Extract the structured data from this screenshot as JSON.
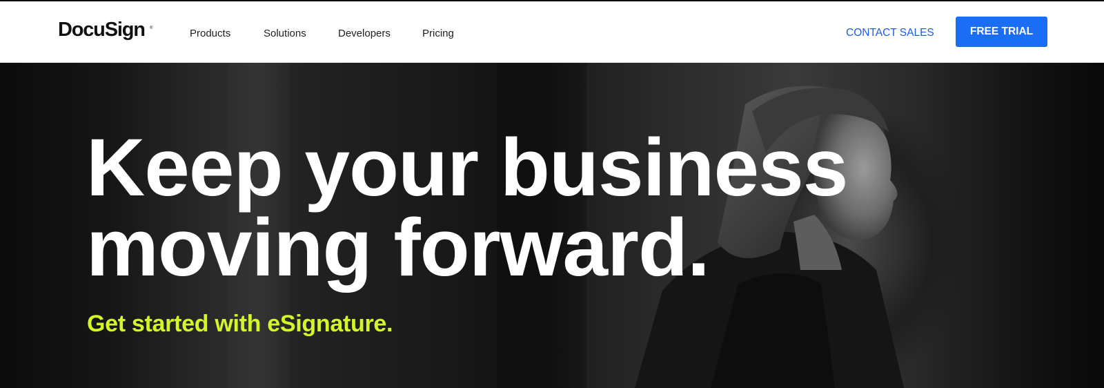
{
  "brand": {
    "name": "DocuSign",
    "registered_mark": "®"
  },
  "nav": {
    "items": [
      {
        "label": "Products"
      },
      {
        "label": "Solutions"
      },
      {
        "label": "Developers"
      },
      {
        "label": "Pricing"
      }
    ],
    "contact_sales": "CONTACT SALES",
    "free_trial": "FREE TRIAL"
  },
  "hero": {
    "headline_line1": "Keep your business",
    "headline_line2": "moving forward.",
    "subheadline": "Get started with eSignature."
  },
  "colors": {
    "accent_blue": "#1a6ef5",
    "link_blue": "#1a5ce5",
    "subheadline_lime": "#d4f52a",
    "hero_text": "#ffffff"
  }
}
